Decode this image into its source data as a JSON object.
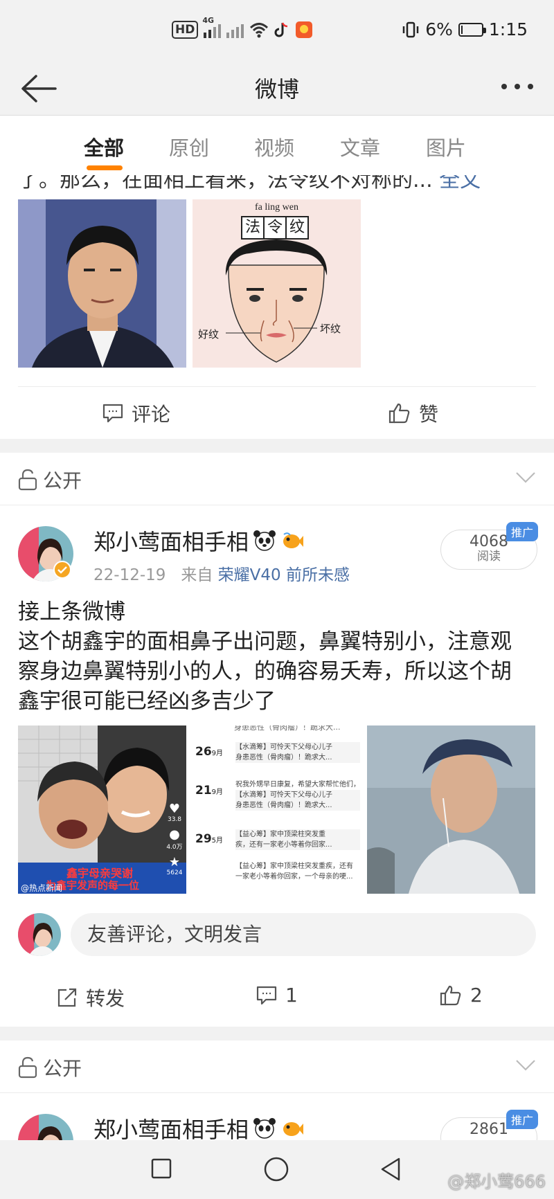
{
  "status_bar": {
    "hd": "HD",
    "network": "4G",
    "battery": "6%",
    "battery_level": 0.06,
    "time": "1:15"
  },
  "app_bar": {
    "title": "微博"
  },
  "tabs": [
    {
      "label": "全部",
      "active": true
    },
    {
      "label": "原创",
      "active": false
    },
    {
      "label": "视频",
      "active": false
    },
    {
      "label": "文章",
      "active": false
    },
    {
      "label": "图片",
      "active": false
    }
  ],
  "post1": {
    "cut_text": "了。那么，在面相上看来，法令纹不对称的...",
    "full_link": "全文",
    "diagram": {
      "pinyin": "fa ling wen",
      "chars": [
        "法",
        "令",
        "纹"
      ],
      "left_label": "好纹",
      "right_label": "坏纹"
    },
    "actions": {
      "comment": "评论",
      "like": "赞"
    }
  },
  "visibility_1": "公开",
  "post2": {
    "username": "郑小莺面相手相",
    "date": "22-12-19",
    "from_prefix": "来自",
    "source": "荣耀V40 前所未感",
    "reads": "4068",
    "reads_label": "阅读",
    "promo_label": "推广",
    "text_lines": [
      "接上条微博",
      "这个胡鑫宇的面相鼻子出问题，鼻翼特别小，注意观",
      "察身边鼻翼特别小的人，的确容易夭寿，所以这个胡",
      "鑫宇很可能已经凶多吉少了"
    ],
    "img1": {
      "caption1": "鑫宇母亲哭谢",
      "caption2": "为鑫宇发声的每一位",
      "counts": [
        "33.8",
        "4.0万",
        "5624"
      ],
      "tag": "@热点新闻"
    },
    "img2": {
      "items": [
        {
          "day": "26",
          "month": "9月",
          "lines": [
            "【水滴筹】可怜天下父母心儿子",
            "身患恶性（骨肉瘤）！跪求大..."
          ]
        },
        {
          "day": "21",
          "month": "9月",
          "lines": [
            "祝我外甥早日康复，希望大家帮忙他们，",
            "【水滴筹】可怜天下父母心儿子",
            "身患恶性（骨肉瘤）！跪求大..."
          ]
        },
        {
          "day": "29",
          "month": "5月",
          "lines": [
            "【益心筹】家中顶梁柱突发重",
            "疾，还有一家老小等着你回家..."
          ]
        }
      ],
      "tail": [
        "【益心筹】家中顶梁柱突发重疾，还有",
        "一家老小等着你回家，一个母亲的哽..."
      ],
      "top": "身患恶性（骨肉瘤）！跪求大..."
    },
    "comment_placeholder": "友善评论，文明发言",
    "actions": {
      "repost": "转发",
      "comments": "1",
      "likes": "2"
    }
  },
  "visibility_2": "公开",
  "post3": {
    "username": "郑小莺面相手相",
    "reads": "2861",
    "promo_label": "推广"
  },
  "watermark": "@郑小莺666"
}
